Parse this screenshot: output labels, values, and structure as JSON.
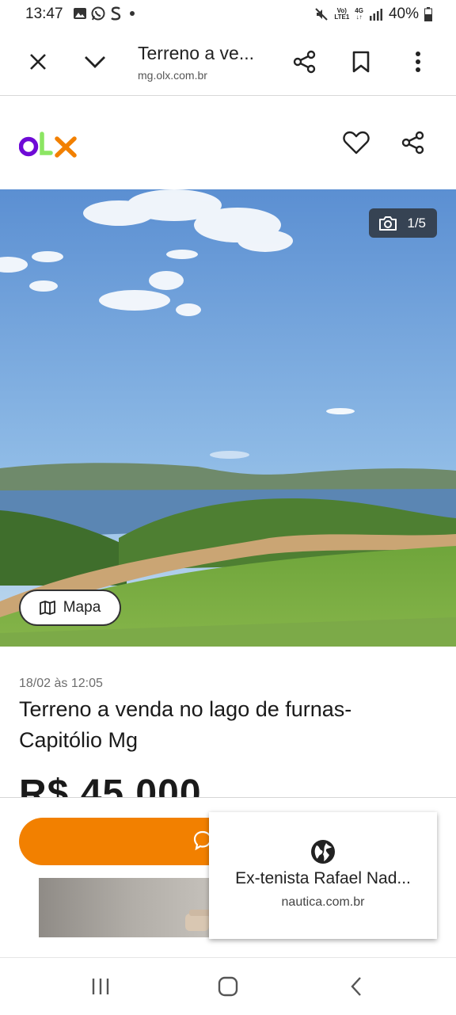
{
  "status_bar": {
    "time": "13:47",
    "battery": "40%",
    "network_top": "Vo)",
    "network_bottom": "LTE1",
    "data_top": "4G",
    "notification_icons": [
      "image-icon",
      "whatsapp-icon",
      "s-app-icon",
      "dot-icon"
    ]
  },
  "browser_bar": {
    "title": "Terreno a ve...",
    "domain": "mg.olx.com.br",
    "icons": [
      "close-icon",
      "chevron-down-icon",
      "share-icon",
      "bookmark-icon",
      "more-vert-icon"
    ]
  },
  "site_header": {
    "logo": "OLX",
    "logo_colors": [
      "#6e0ad6",
      "#8ce563",
      "#f28000"
    ],
    "icons": [
      "heart-icon",
      "share-icon"
    ]
  },
  "gallery": {
    "counter": "1/5",
    "map_button": "Mapa"
  },
  "listing": {
    "date": "18/02 às 12:05",
    "title": "Terreno a venda no lago de furnas-Capitólio Mg",
    "price": "R$ 45.000"
  },
  "action": {
    "chat_color": "#f28000"
  },
  "popup": {
    "title": "Ex-tenista Rafael Nad...",
    "domain": "nautica.com.br"
  },
  "nav_bar": {
    "icons": [
      "recents-icon",
      "home-icon",
      "back-icon"
    ]
  }
}
